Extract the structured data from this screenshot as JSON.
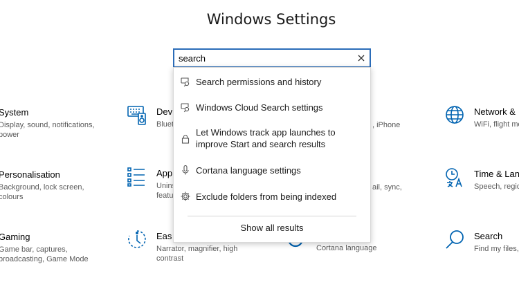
{
  "window": {
    "title": "Windows Settings"
  },
  "search": {
    "value": "search",
    "placeholder": ""
  },
  "suggestions": [
    {
      "label": "Search permissions and history",
      "icon": "shield-search-icon"
    },
    {
      "label": "Windows Cloud Search settings",
      "icon": "shield-search-icon"
    },
    {
      "label": "Let Windows track app launches to",
      "label2": "improve Start and search results",
      "icon": "lock-icon"
    },
    {
      "label": "Cortana language settings",
      "icon": "microphone-icon"
    },
    {
      "label": "Exclude folders from being indexed",
      "icon": "gear-icon"
    }
  ],
  "show_all": "Show all results",
  "tiles": {
    "system": {
      "name": "System",
      "desc1": "Display, sound, notifications,",
      "desc2": "power"
    },
    "devices": {
      "name": "Devi",
      "desc1": "Bluet",
      "desc2": ""
    },
    "phone": {
      "name": "",
      "desc1": ", iPhone",
      "desc2": ""
    },
    "network": {
      "name": "Network &",
      "desc1": "WiFi, flight mo",
      "desc2": ""
    },
    "personalisation": {
      "name": "Personalisation",
      "desc1": "Background, lock screen,",
      "desc2": "colours"
    },
    "apps": {
      "name": "App",
      "desc1": "Unins",
      "desc2": "featu"
    },
    "accounts": {
      "name": "",
      "desc1": "ail, sync,",
      "desc2": ""
    },
    "time": {
      "name": "Time & Lang",
      "desc1": "Speech, regio",
      "desc2": ""
    },
    "gaming": {
      "name": "Gaming",
      "desc1": "Game bar, captures,",
      "desc2": "broadcasting, Game Mode"
    },
    "ease": {
      "name": "Eas",
      "desc1": "Narrator, magnifier, high",
      "desc2": "contrast"
    },
    "cortana": {
      "name": "",
      "desc1": "Cortana language",
      "desc2": ""
    },
    "search_tile": {
      "name": "Search",
      "desc1": "Find my files, p",
      "desc2": ""
    }
  },
  "colors": {
    "accent": "#2b6cb8",
    "icon": "#0063b1"
  }
}
